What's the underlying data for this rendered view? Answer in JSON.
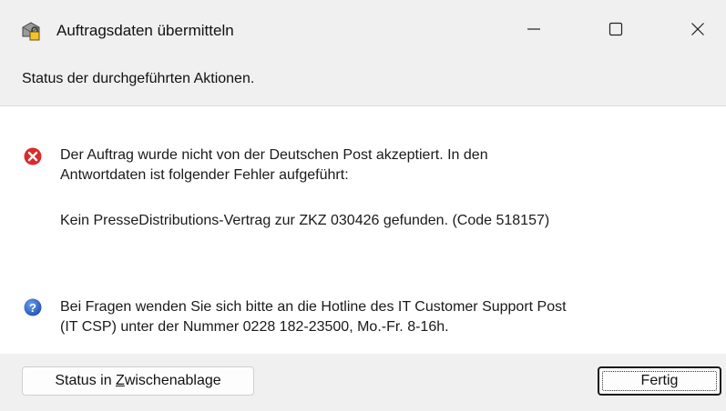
{
  "window": {
    "title": "Auftragsdaten übermitteln",
    "icon": "envelope-lock-icon"
  },
  "header": {
    "text": "Status der durchgeführten Aktionen."
  },
  "messages": {
    "error": {
      "icon": "error-icon",
      "line1": "Der Auftrag wurde nicht von der Deutschen Post akzeptiert. In den",
      "line2": "Antwortdaten ist folgender Fehler aufgeführt:",
      "detail": "Kein PresseDistributions-Vertrag zur ZKZ 030426 gefunden. (Code 518157)"
    },
    "info": {
      "icon": "help-icon",
      "line1": "Bei Fragen wenden Sie sich bitte an die Hotline des IT Customer Support Post",
      "line2": "(IT CSP) unter der Nummer 0228 182-23500, Mo.-Fr. 8-16h."
    }
  },
  "buttons": {
    "clipboard_prefix": "Status in ",
    "clipboard_mnemonic": "Z",
    "clipboard_suffix": "wischenablage",
    "done_label": "Fertig"
  },
  "colors": {
    "error": "#d92b2b",
    "info": "#2a63c9",
    "content_bg": "#ffffff",
    "chrome_bg": "#f0f0f0"
  }
}
